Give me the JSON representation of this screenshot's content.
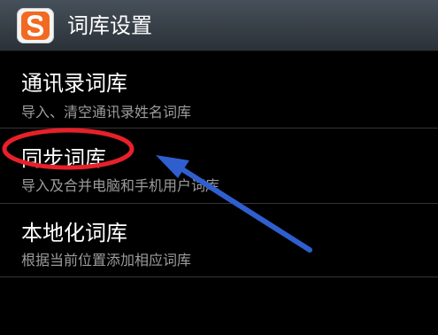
{
  "header": {
    "app_icon": "sogou-s-logo",
    "title": "词库设置"
  },
  "items": [
    {
      "title": "通讯录词库",
      "subtitle": "导入、清空通讯录姓名词库"
    },
    {
      "title": "同步词库",
      "subtitle": "导入及合并电脑和手机用户词库"
    },
    {
      "title": "本地化词库",
      "subtitle": "根据当前位置添加相应词库"
    }
  ],
  "annotation": {
    "highlight_color": "#e8202a",
    "arrow_color": "#2f5fcf"
  },
  "colors": {
    "background": "#000000",
    "title_bar": "#3a4249",
    "logo": "#f26a21"
  }
}
